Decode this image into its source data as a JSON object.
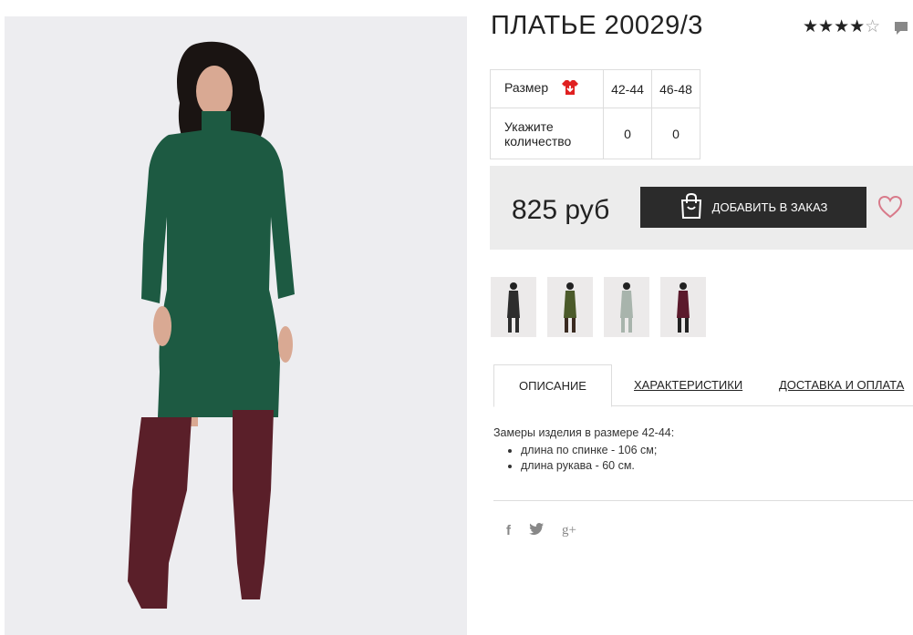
{
  "product": {
    "title": "ПЛАТЬЕ 20029/3",
    "rating": 4,
    "rating_max": 5,
    "rating_stars_filled": "★★★★",
    "rating_stars_empty": "☆"
  },
  "sizes_table": {
    "size_label": "Размер",
    "sizes": [
      "42-44",
      "46-48"
    ],
    "quantity_label_line1": "Укажите",
    "quantity_label_line2": "количество",
    "quantities": [
      "0",
      "0"
    ]
  },
  "buy": {
    "price": "825 руб",
    "add_button_label": "ДОБАВИТЬ В ЗАКАЗ"
  },
  "thumbnails": [
    {
      "color": "#2d2d2d"
    },
    {
      "color": "#4b5a2a"
    },
    {
      "color": "#a8b4ac"
    },
    {
      "color": "#5b1a2c"
    }
  ],
  "tabs": [
    {
      "label": "ОПИСАНИЕ"
    },
    {
      "label": "ХАРАКТЕРИСТИКИ"
    },
    {
      "label": "ДОСТАВКА И ОПЛАТА"
    }
  ],
  "description": {
    "intro": "Замеры изделия в размере 42-44:",
    "items": [
      "длина по спинке - 106 см;",
      "длина рукава - 60 см."
    ]
  },
  "social": {
    "facebook": "f",
    "google_plus": "g+"
  },
  "colors": {
    "dress": "#1d5a42",
    "boots": "#5a1f29",
    "size_icon": "#e02020",
    "heart": "#d87a8a",
    "button_bg": "#2b2b2b"
  }
}
